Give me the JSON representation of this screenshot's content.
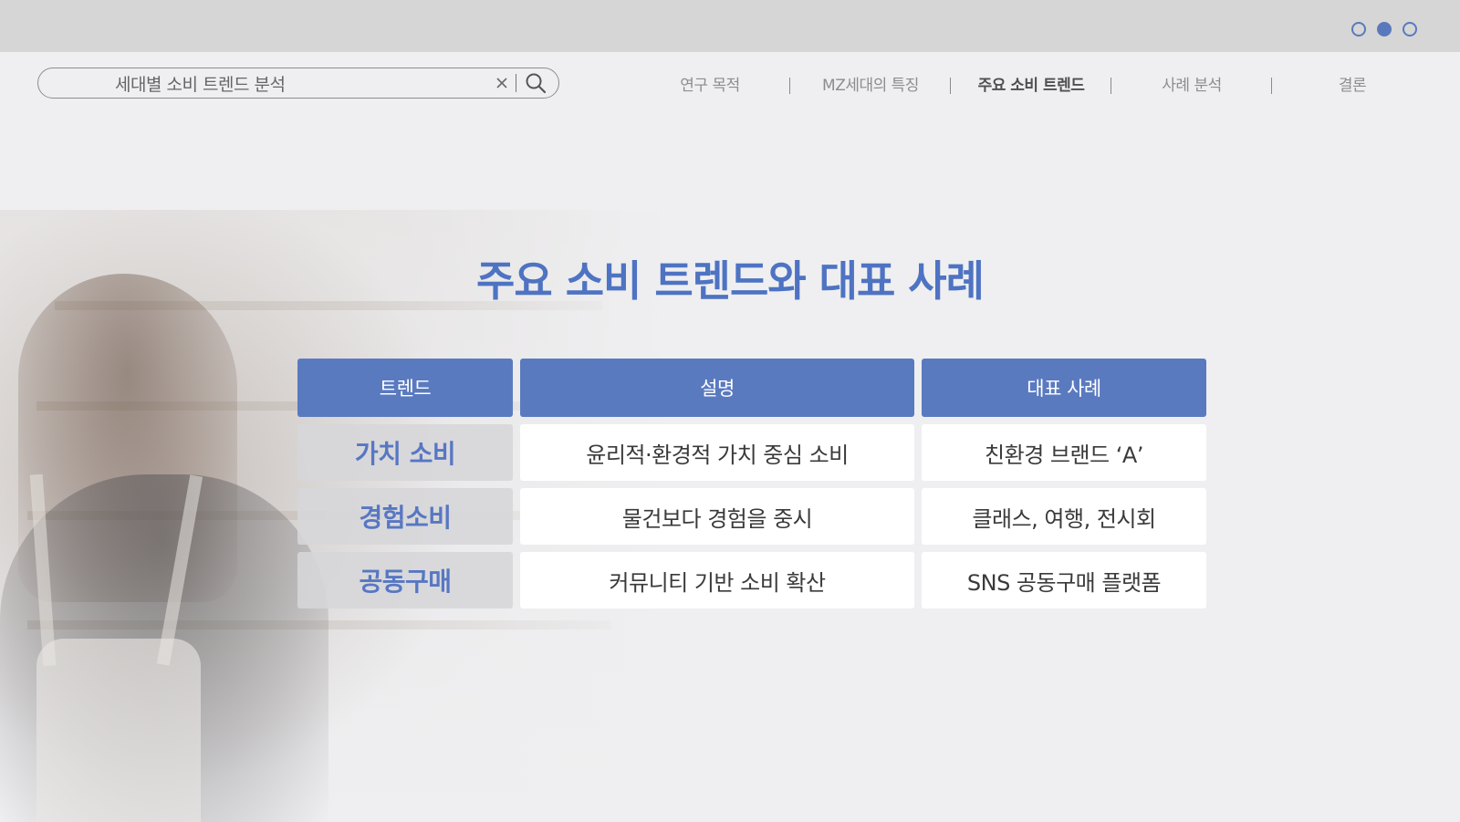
{
  "window": {
    "pager_dots": [
      {
        "active": false
      },
      {
        "active": true
      },
      {
        "active": false
      }
    ],
    "accent_color": "#5a79bd"
  },
  "search": {
    "value": "세대별 소비 트렌드 분석",
    "clear_glyph": "×",
    "search_icon": "search-icon"
  },
  "nav": {
    "items": [
      {
        "label": "연구 목적",
        "active": false
      },
      {
        "label": "MZ세대의 특징",
        "active": false
      },
      {
        "label": "주요 소비 트렌드",
        "active": true
      },
      {
        "label": "사례 분석",
        "active": false
      },
      {
        "label": "결론",
        "active": false
      }
    ]
  },
  "main": {
    "title": "주요 소비 트렌드와 대표 사례",
    "table": {
      "headers": [
        "트렌드",
        "설명",
        "대표 사례"
      ],
      "rows": [
        [
          "가치 소비",
          "윤리적·환경적 가치 중심 소비",
          "친환경 브랜드 ‘A’"
        ],
        [
          "경험소비",
          "물건보다 경험을 중시",
          "클래스, 여행, 전시회"
        ],
        [
          "공동구매",
          "커뮤니티 기반 소비 확산",
          "SNS 공동구매 플랫폼"
        ]
      ]
    },
    "header_color": "#5a7ac0",
    "title_color": "#4e73c2"
  }
}
